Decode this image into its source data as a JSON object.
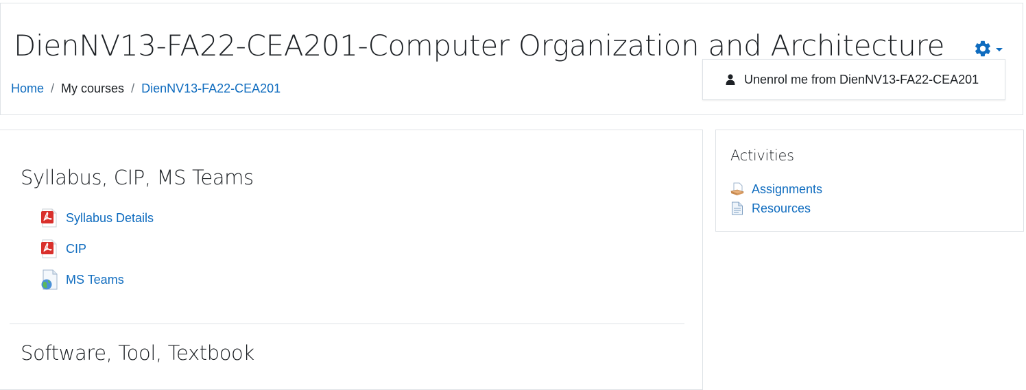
{
  "header": {
    "title": "DienNV13-FA22-CEA201-Computer Organization and Architecture",
    "breadcrumb": {
      "home": "Home",
      "my_courses": "My courses",
      "course": "DienNV13-FA22-CEA201",
      "separator": "/"
    },
    "settings_icon": "gear-icon",
    "dropdown": {
      "item_label": "Unenrol me from DienNV13-FA22-CEA201",
      "item_icon": "user-icon"
    }
  },
  "sections": [
    {
      "title": "Syllabus, CIP, MS Teams",
      "activities": [
        {
          "label": "Syllabus Details",
          "icon": "pdf-icon"
        },
        {
          "label": "CIP",
          "icon": "pdf-icon"
        },
        {
          "label": "MS Teams",
          "icon": "url-globe-icon"
        }
      ]
    },
    {
      "title": "Software, Tool, Textbook"
    }
  ],
  "activities_block": {
    "title": "Activities",
    "items": [
      {
        "label": "Assignments",
        "icon": "assignment-icon"
      },
      {
        "label": "Resources",
        "icon": "resource-icon"
      }
    ]
  },
  "colors": {
    "link": "#0f6cbf",
    "text": "#1d2125",
    "border": "#dee2e6",
    "pdf_red": "#d9302c"
  }
}
